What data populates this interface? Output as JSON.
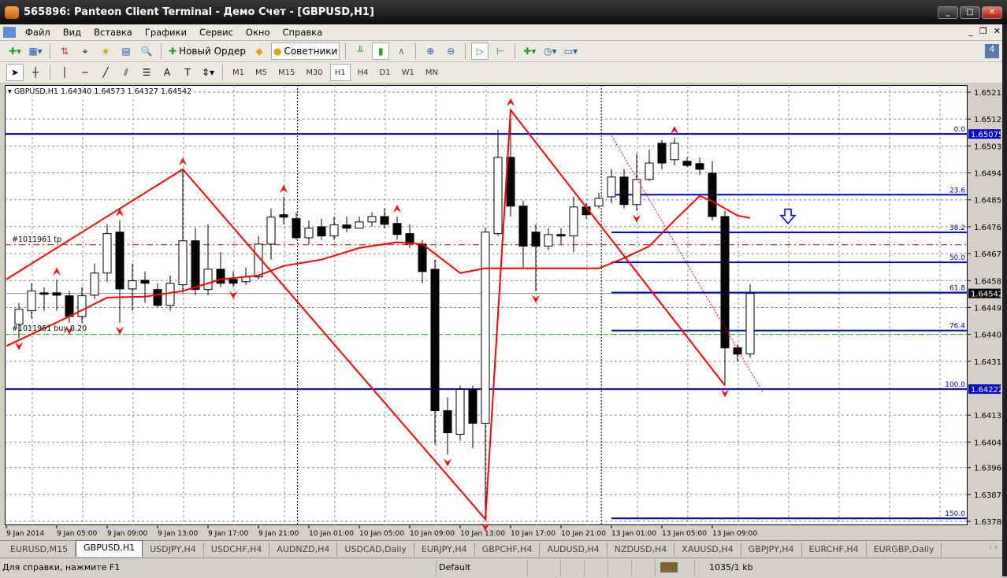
{
  "window": {
    "title": "565896: Panteon Client Terminal - Демо Счет - [GBPUSD,H1]"
  },
  "menu": [
    "Файл",
    "Вид",
    "Вставка",
    "Графики",
    "Сервис",
    "Окно",
    "Справка"
  ],
  "toolbar": {
    "new_order": "Новый Ордер",
    "experts": "Советники"
  },
  "timeframes": [
    "M1",
    "M5",
    "M15",
    "M30",
    "H1",
    "H4",
    "D1",
    "W1",
    "MN"
  ],
  "active_timeframe": "H1",
  "chart_header": "GBPUSD,H1  1.64340 1.64573 1.64327 1.64542",
  "order_labels": {
    "tp": "#1011961 tp",
    "buy": "#1011961 buy 0.20"
  },
  "colors": {
    "bull": "#ffffff",
    "bear": "#000000",
    "zigzag": "#ff0000",
    "fib": "#0000cc",
    "grid": "#7f8a99",
    "tp": "#ff0000",
    "buy": "#00cc00"
  },
  "chart_data": {
    "type": "candlestick",
    "symbol": "GBPUSD",
    "timeframe": "H1",
    "ylim": [
      1.6376,
      1.6524
    ],
    "price_ticks": [
      "1.65215",
      "1.65125",
      "1.65035",
      "1.64945",
      "1.64855",
      "1.64765",
      "1.64675",
      "1.64585",
      "1.64495",
      "1.64405",
      "1.64315",
      "1.64135",
      "1.64045",
      "1.63960",
      "1.63870",
      "1.63780"
    ],
    "price_tags": [
      {
        "text": "1.65075",
        "bg": "#0000cc"
      },
      {
        "text": "1.64542",
        "bg": "#000000"
      },
      {
        "text": "1.64222",
        "bg": "#0000cc"
      }
    ],
    "time_ticks": [
      "9 Jan 2014",
      "9 Jan 05:00",
      "9 Jan 09:00",
      "9 Jan 13:00",
      "9 Jan 17:00",
      "9 Jan 21:00",
      "10 Jan 01:00",
      "10 Jan 05:00",
      "10 Jan 09:00",
      "10 Jan 13:00",
      "10 Jan 17:00",
      "10 Jan 21:00",
      "13 Jan 01:00",
      "13 Jan 05:00",
      "13 Jan 09:00"
    ],
    "ohlc": [
      [
        1.64439,
        1.6451,
        1.64392,
        1.64489
      ],
      [
        1.64484,
        1.64576,
        1.64458,
        1.6455
      ],
      [
        1.64544,
        1.64563,
        1.64484,
        1.64539
      ],
      [
        1.64544,
        1.64589,
        1.64484,
        1.64536
      ],
      [
        1.64534,
        1.6455,
        1.64444,
        1.64465
      ],
      [
        1.64465,
        1.64563,
        1.64444,
        1.64534
      ],
      [
        1.64536,
        1.64642,
        1.64523,
        1.6461
      ],
      [
        1.6461,
        1.64773,
        1.64581,
        1.64742
      ],
      [
        1.64747,
        1.64786,
        1.64444,
        1.64557
      ],
      [
        1.64557,
        1.64642,
        1.64484,
        1.64584
      ],
      [
        1.64586,
        1.64615,
        1.6451,
        1.64576
      ],
      [
        1.64555,
        1.64576,
        1.64497,
        1.64502
      ],
      [
        1.64502,
        1.64602,
        1.64484,
        1.64576
      ],
      [
        1.64571,
        1.64957,
        1.64544,
        1.64718
      ],
      [
        1.64718,
        1.6476,
        1.64536,
        1.64555
      ],
      [
        1.64555,
        1.64773,
        1.64536,
        1.64623
      ],
      [
        1.64623,
        1.64681,
        1.64563,
        1.64576
      ],
      [
        1.64589,
        1.64615,
        1.64563,
        1.64576
      ],
      [
        1.64581,
        1.64629,
        1.64571,
        1.64597
      ],
      [
        1.64597,
        1.64734,
        1.64589,
        1.64707
      ],
      [
        1.64707,
        1.64826,
        1.64655,
        1.64797
      ],
      [
        1.64805,
        1.64865,
        1.64773,
        1.64797
      ],
      [
        1.64792,
        1.64813,
        1.64721,
        1.64728
      ],
      [
        1.64728,
        1.64786,
        1.64707,
        1.6476
      ],
      [
        1.64765,
        1.64792,
        1.64721,
        1.64734
      ],
      [
        1.64734,
        1.64799,
        1.64721,
        1.64771
      ],
      [
        1.64771,
        1.64799,
        1.64747,
        1.6476
      ],
      [
        1.6476,
        1.64799,
        1.6476,
        1.64781
      ],
      [
        1.64781,
        1.64813,
        1.64765,
        1.64799
      ],
      [
        1.64799,
        1.64826,
        1.6476,
        1.64773
      ],
      [
        1.64776,
        1.64799,
        1.64721,
        1.64739
      ],
      [
        1.64742,
        1.64773,
        1.64694,
        1.64707
      ],
      [
        1.64707,
        1.64721,
        1.64576,
        1.64615
      ],
      [
        1.64623,
        1.64655,
        1.64037,
        1.6415
      ],
      [
        1.6415,
        1.64195,
        1.64003,
        1.64076
      ],
      [
        1.64071,
        1.64234,
        1.6405,
        1.64221
      ],
      [
        1.64221,
        1.64234,
        1.64024,
        1.64108
      ],
      [
        1.64108,
        1.6476,
        1.63787,
        1.64747
      ],
      [
        1.64742,
        1.65089,
        1.64734,
        1.64997
      ],
      [
        1.64997,
        1.65155,
        1.64799,
        1.64834
      ],
      [
        1.64834,
        1.64852,
        1.64629,
        1.647
      ],
      [
        1.64747,
        1.64773,
        1.6455,
        1.647
      ],
      [
        1.647,
        1.6476,
        1.64687,
        1.64739
      ],
      [
        1.64739,
        1.6476,
        1.64707,
        1.64734
      ],
      [
        1.64734,
        1.64865,
        1.64681,
        1.64831
      ],
      [
        1.64831,
        1.64844,
        1.64792,
        1.64805
      ],
      [
        1.64834,
        1.64878,
        1.64826,
        1.6486
      ],
      [
        1.64865,
        1.64957,
        1.64844,
        1.64931
      ],
      [
        1.64931,
        1.64957,
        1.64826,
        1.64839
      ],
      [
        1.64839,
        1.6501,
        1.64818,
        1.64923
      ],
      [
        1.64923,
        1.65023,
        1.64918,
        1.64978
      ],
      [
        1.65044,
        1.65055,
        1.64957,
        1.64978
      ],
      [
        1.64989,
        1.65062,
        1.6497,
        1.65044
      ],
      [
        1.64984,
        1.64997,
        1.64965,
        1.6497
      ],
      [
        1.64976,
        1.64997,
        1.64939,
        1.64957
      ],
      [
        1.64944,
        1.64984,
        1.64786,
        1.64799
      ],
      [
        1.64799,
        1.64818,
        1.64234,
        1.6436
      ],
      [
        1.6436,
        1.64371,
        1.64313,
        1.64339
      ],
      [
        1.6434,
        1.64573,
        1.64327,
        1.64542
      ]
    ],
    "ma": [
      [
        0,
        1.64366
      ],
      [
        5,
        1.64465
      ],
      [
        8,
        1.64528
      ],
      [
        11,
        1.64531
      ],
      [
        14,
        1.6455
      ],
      [
        17,
        1.64589
      ],
      [
        20,
        1.64602
      ],
      [
        22,
        1.64634
      ],
      [
        25,
        1.64655
      ],
      [
        28,
        1.64694
      ],
      [
        31,
        1.64713
      ],
      [
        33,
        1.64707
      ],
      [
        36,
        1.6461
      ],
      [
        38,
        1.64626
      ],
      [
        47,
        1.64626
      ],
      [
        49,
        1.6466
      ],
      [
        51,
        1.647
      ],
      [
        53,
        1.64786
      ],
      [
        55,
        1.64868
      ],
      [
        56,
        1.6485
      ],
      [
        58,
        1.64802
      ],
      [
        59,
        1.64794
      ]
    ],
    "zigzag": [
      [
        0,
        1.64589
      ],
      [
        14,
        1.64957
      ],
      [
        38,
        1.63787
      ],
      [
        40,
        1.65155
      ],
      [
        57,
        1.64234
      ]
    ],
    "trendline_dashed": [
      [
        48,
        1.6507
      ],
      [
        60,
        1.64212
      ]
    ],
    "markers": [
      {
        "bar": 4,
        "dir": "up"
      },
      {
        "bar": 9,
        "dir": "up"
      },
      {
        "bar": 14,
        "dir": "up"
      },
      {
        "bar": 22,
        "dir": "up"
      },
      {
        "bar": 31,
        "dir": "up"
      },
      {
        "bar": 40,
        "dir": "up"
      },
      {
        "bar": 53,
        "dir": "up"
      },
      {
        "bar": 1,
        "dir": "down"
      },
      {
        "bar": 5,
        "dir": "down"
      },
      {
        "bar": 9,
        "dir": "down"
      },
      {
        "bar": 18,
        "dir": "down"
      },
      {
        "bar": 35,
        "dir": "down"
      },
      {
        "bar": 38,
        "dir": "down"
      },
      {
        "bar": 42,
        "dir": "down"
      },
      {
        "bar": 50,
        "dir": "down"
      },
      {
        "bar": 57,
        "dir": "down"
      }
    ],
    "fib": {
      "start_bar": 48,
      "levels": [
        {
          "label": "0.0",
          "price": 1.65075,
          "full": true
        },
        {
          "label": "23.6",
          "price": 1.64872
        },
        {
          "label": "38.2",
          "price": 1.64746
        },
        {
          "label": "50.0",
          "price": 1.64646
        },
        {
          "label": "61.8",
          "price": 1.64545
        },
        {
          "label": "76.4",
          "price": 1.64418
        },
        {
          "label": "100.0",
          "price": 1.64222,
          "full": true
        },
        {
          "label": "150.0",
          "price": 1.6379
        }
      ]
    },
    "tp_price": 1.64705,
    "buy_price": 1.64405,
    "current_price": 1.64542,
    "arrow": {
      "bar": 62,
      "price": 1.64792
    },
    "day_separators": [
      23.1,
      47.2
    ]
  },
  "tabs": [
    "EURUSD,M15",
    "GBPUSD,H1",
    "USDJPY,H4",
    "USDCHF,H4",
    "AUDNZD,H4",
    "USDCAD,Daily",
    "EURJPY,H4",
    "GBPCHF,H4",
    "AUDUSD,H4",
    "NZDUSD,H4",
    "XAUUSD,H4",
    "GBPJPY,H4",
    "EURCHF,H4",
    "EURGBP,Daily"
  ],
  "active_tab": "GBPUSD,H1",
  "status": {
    "help": "Для справки, нажмите F1",
    "profile": "Default",
    "traffic": "1035/1 kb"
  }
}
